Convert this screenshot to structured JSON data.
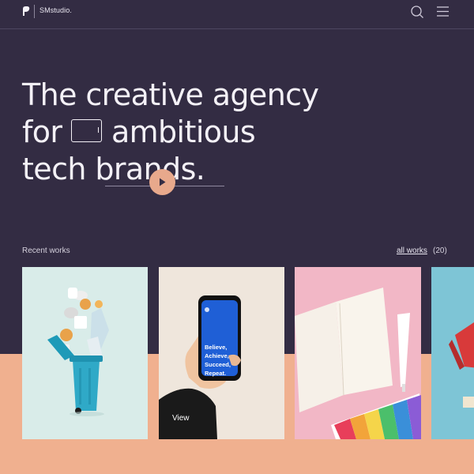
{
  "header": {
    "brand": "SMstudio.",
    "logo_icon": "studio-logo-icon",
    "search_icon": "search-icon",
    "menu_icon": "hamburger-menu-icon"
  },
  "hero": {
    "line1": "The creative agency",
    "line2_prefix": "for",
    "line2_suffix": "ambitious",
    "line3_prefix": "tech",
    "line3_highlight": "brands.",
    "play_icon": "play-icon"
  },
  "works": {
    "label": "Recent works",
    "all_link": "all works",
    "count": "(20)",
    "cards": [
      {
        "image": "recycling-bin-photo"
      },
      {
        "image": "phone-in-hand-photo",
        "phone_text": "Believe, Achieve, Succeed, Repeat.",
        "action": "View"
      },
      {
        "image": "notebook-and-swatches-photo"
      },
      {
        "image": "red-notebook-photo"
      }
    ]
  },
  "colors": {
    "hero_bg": "#332c43",
    "page_bg": "#f0b08f",
    "text_light": "#f4f1f7",
    "accent": "#e8a98c"
  }
}
